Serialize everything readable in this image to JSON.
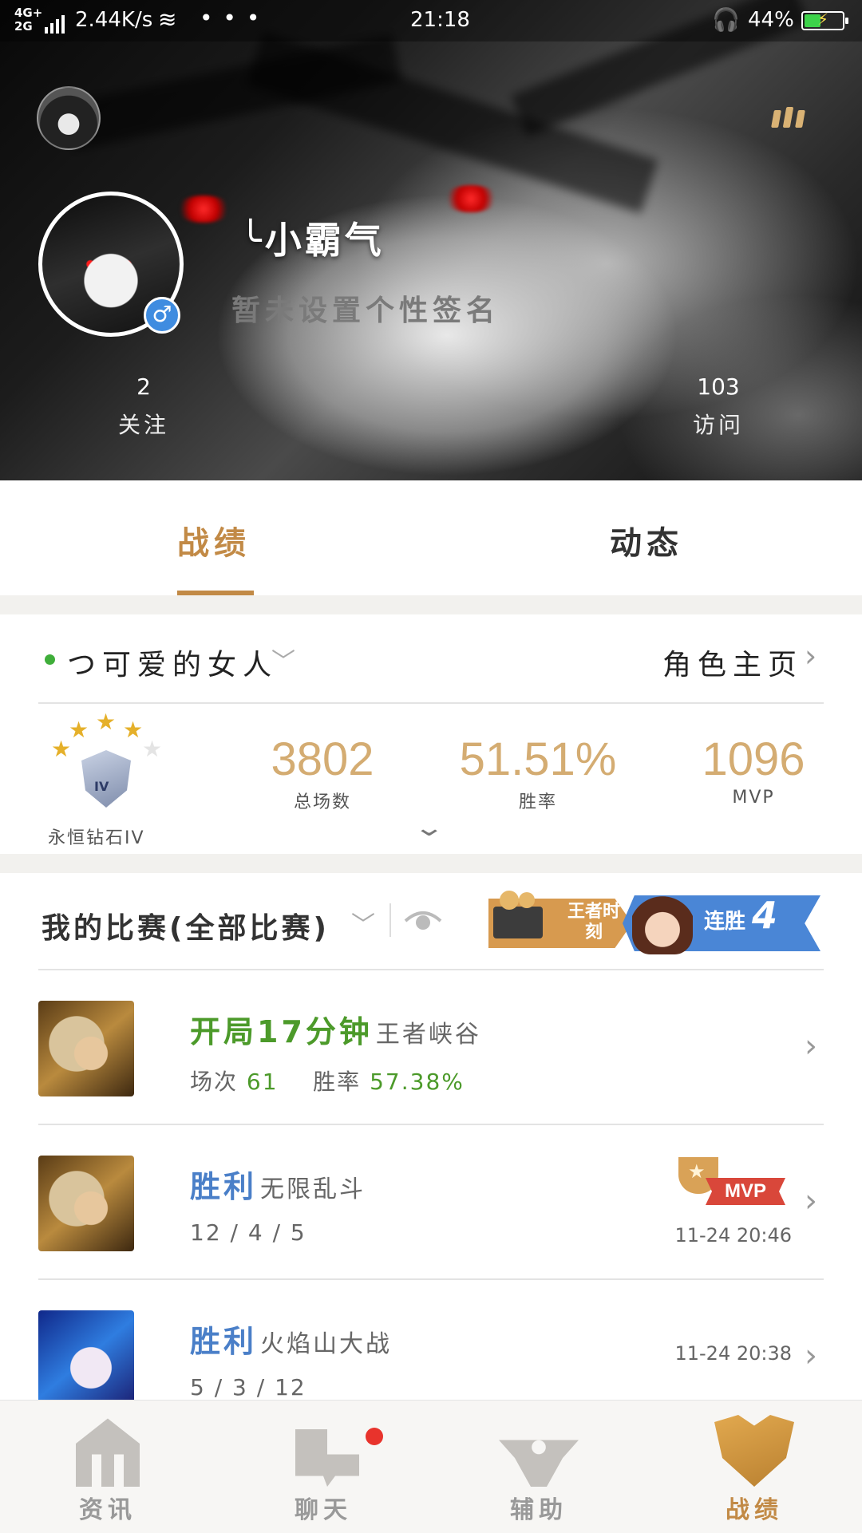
{
  "status_bar": {
    "network": "4G+\n2G",
    "speed": "2.44K/s",
    "more": "• • •",
    "time": "21:18",
    "battery_pct": "44%",
    "battery_level": 0.44
  },
  "profile": {
    "nickname": "╰小霸气",
    "signature": "暂未设置个性签名",
    "gender": "♂",
    "follow_count": "2",
    "follow_label": "关注",
    "visit_count": "103",
    "visit_label": "访问"
  },
  "tabs": {
    "active": "战绩",
    "inactive": "动态"
  },
  "role": {
    "name": "つ可爱的女人",
    "home_link": "角色主页",
    "rank_name": "永恒钻石IV",
    "rank_tier": "IV",
    "rank_stars": 4,
    "stats": [
      {
        "value": "3802",
        "label": "总场数"
      },
      {
        "value": "51.51%",
        "label": "胜率"
      },
      {
        "value": "1096",
        "label": "MVP"
      }
    ]
  },
  "matches": {
    "title": "我的比赛(全部比赛)",
    "banner_left": "王者时刻",
    "banner_streak_label": "连胜",
    "banner_streak_count": "4",
    "rows": [
      {
        "title": "开局17分钟",
        "mode": "王者峡谷",
        "sub_games_label": "场次",
        "sub_games": "61",
        "sub_rate_label": "胜率",
        "sub_rate": "57.38%"
      },
      {
        "title": "胜利",
        "mode": "无限乱斗",
        "kda": "12 / 4 / 5",
        "badge": "MVP",
        "time": "11-24 20:46"
      },
      {
        "title": "胜利",
        "mode": "火焰山大战",
        "kda": "5 / 3 / 12",
        "time": "11-24 20:38"
      }
    ]
  },
  "bottom_nav": {
    "items": [
      {
        "label": "资讯"
      },
      {
        "label": "聊天"
      },
      {
        "label": "辅助"
      },
      {
        "label": "战绩"
      }
    ]
  },
  "colors": {
    "accent": "#c28a46",
    "win_blue": "#4a7fc8",
    "green": "#4c9a2a",
    "badge_red": "#e8332c"
  }
}
